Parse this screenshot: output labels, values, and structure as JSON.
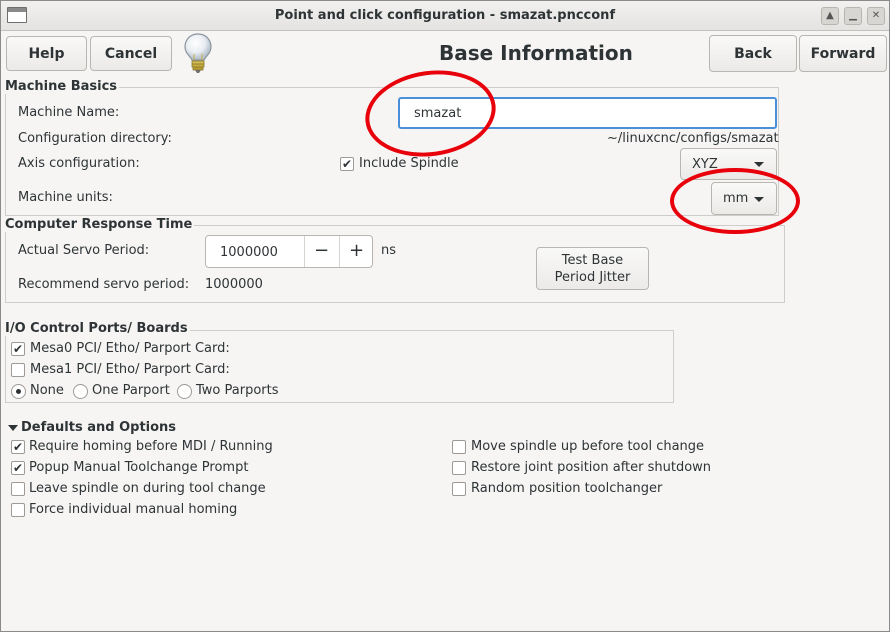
{
  "window": {
    "title": "Point and click configuration - smazat.pncconf"
  },
  "toolbar": {
    "help_label": "Help",
    "cancel_label": "Cancel",
    "back_label": "Back",
    "forward_label": "Forward",
    "heading": "Base Information"
  },
  "machine_basics": {
    "section_label": "Machine Basics",
    "name_label": "Machine Name:",
    "name_value": "smazat",
    "config_dir_label": "Configuration directory:",
    "config_dir_value": "~/linuxcnc/configs/smazat",
    "axis_label": "Axis configuration:",
    "include_spindle_label": "Include Spindle",
    "include_spindle_checked": true,
    "axis_value": "XYZ",
    "units_label": "Machine units:",
    "units_value": "mm"
  },
  "response_time": {
    "section_label": "Computer Response Time",
    "servo_label": "Actual Servo Period:",
    "servo_value": "1000000",
    "servo_unit": "ns",
    "minus_label": "−",
    "plus_label": "+",
    "test_button_line1": "Test Base",
    "test_button_line2": "Period Jitter",
    "recommend_label": "Recommend servo period:",
    "recommend_value": "1000000"
  },
  "io_ports": {
    "section_label": "I/O Control Ports/ Boards",
    "mesa0_label": "Mesa0 PCI/ Etho/ Parport Card:",
    "mesa0_checked": true,
    "mesa1_label": "Mesa1 PCI/ Etho/ Parport Card:",
    "mesa1_checked": false,
    "radio_none_label": "None",
    "radio_one_label": "One Parport",
    "radio_two_label": "Two Parports",
    "selected": "None"
  },
  "defaults": {
    "section_label": "Defaults and Options",
    "left": [
      {
        "label": "Require homing before MDI / Running",
        "checked": true
      },
      {
        "label": "Popup Manual Toolchange Prompt",
        "checked": true
      },
      {
        "label": "Leave spindle on during tool change",
        "checked": false
      },
      {
        "label": "Force individual manual homing",
        "checked": false
      }
    ],
    "right": [
      {
        "label": "Move spindle up before tool change",
        "checked": false
      },
      {
        "label": "Restore joint position after shutdown",
        "checked": false
      },
      {
        "label": "Random position toolchanger",
        "checked": false
      }
    ]
  },
  "icons": {
    "hint": "lightbulb-icon",
    "checkmark_glyph": "✔"
  },
  "colors": {
    "annotation": "#e8000b",
    "focus": "#4a90d9"
  }
}
